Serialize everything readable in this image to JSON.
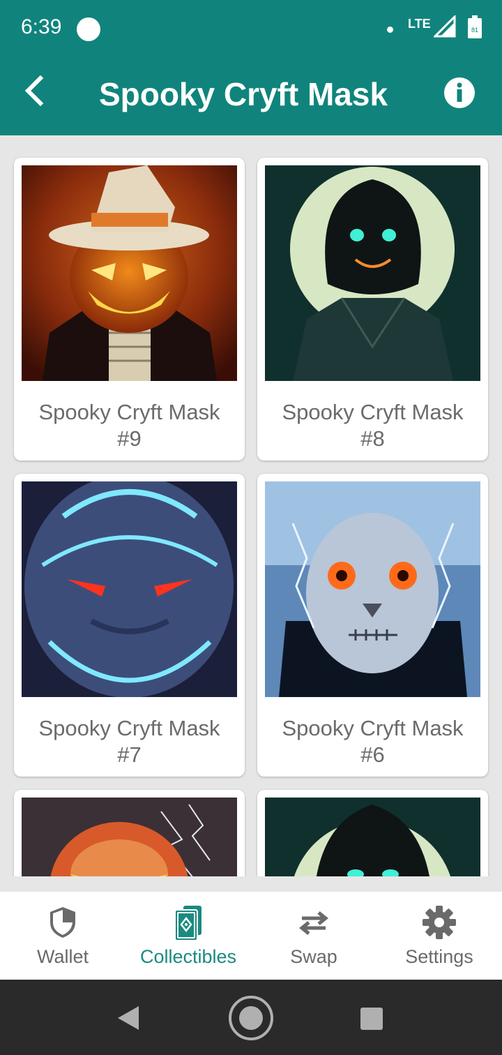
{
  "status_bar": {
    "time": "6:39",
    "network": "LTE",
    "battery": "81"
  },
  "app_bar": {
    "title": "Spooky Cryft Mask"
  },
  "collectibles": [
    {
      "name": "Spooky Cryft Mask",
      "number": "#9",
      "image": "pumpkin-witch-image"
    },
    {
      "name": "Spooky Cryft Mask",
      "number": "#8",
      "image": "moon-shadow-image"
    },
    {
      "name": "Spooky Cryft Mask",
      "number": "#7",
      "image": "lightning-beast-image"
    },
    {
      "name": "Spooky Cryft Mask",
      "number": "#6",
      "image": "storm-skull-image"
    },
    {
      "name": "",
      "number": "",
      "image": "red-pumpkin-image"
    },
    {
      "name": "",
      "number": "",
      "image": "moon-shadow-image"
    }
  ],
  "bottom_nav": {
    "items": [
      {
        "label": "Wallet",
        "icon": "shield-icon"
      },
      {
        "label": "Collectibles",
        "icon": "collectibles-icon",
        "active": true
      },
      {
        "label": "Swap",
        "icon": "swap-icon"
      },
      {
        "label": "Settings",
        "icon": "gear-icon"
      }
    ]
  },
  "colors": {
    "primary": "#10847c",
    "active_nav": "#1a8a80",
    "background": "#e6e6e6"
  }
}
